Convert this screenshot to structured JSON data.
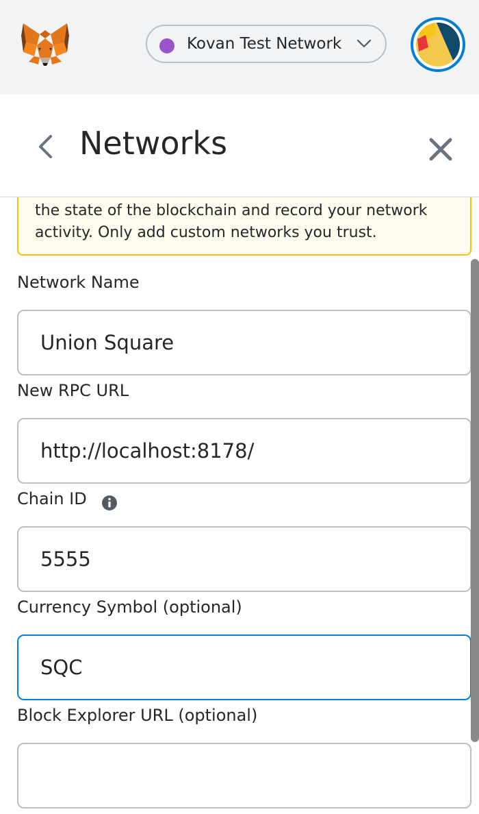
{
  "header": {
    "network_name": "Kovan Test Network",
    "network_color": "#9a56c9",
    "logo_icon": "metamask-fox-icon",
    "avatar_icon": "account-identicon"
  },
  "page": {
    "title": "Networks",
    "back_icon": "chevron-left-icon",
    "close_icon": "close-icon"
  },
  "warning": {
    "text": "the state of the blockchain and record your network activity. Only add custom networks you trust."
  },
  "form": {
    "network_name": {
      "label": "Network Name",
      "value": "Union Square"
    },
    "rpc_url": {
      "label": "New RPC URL",
      "value": "http://localhost:8178/"
    },
    "chain_id": {
      "label": "Chain ID",
      "value": "5555"
    },
    "currency_symbol": {
      "label": "Currency Symbol (optional)",
      "value": "SQC"
    },
    "block_explorer": {
      "label": "Block Explorer URL (optional)",
      "value": ""
    }
  },
  "colors": {
    "accent": "#037dd6",
    "warning_border": "#f8c000",
    "warning_bg": "#fefcef"
  }
}
